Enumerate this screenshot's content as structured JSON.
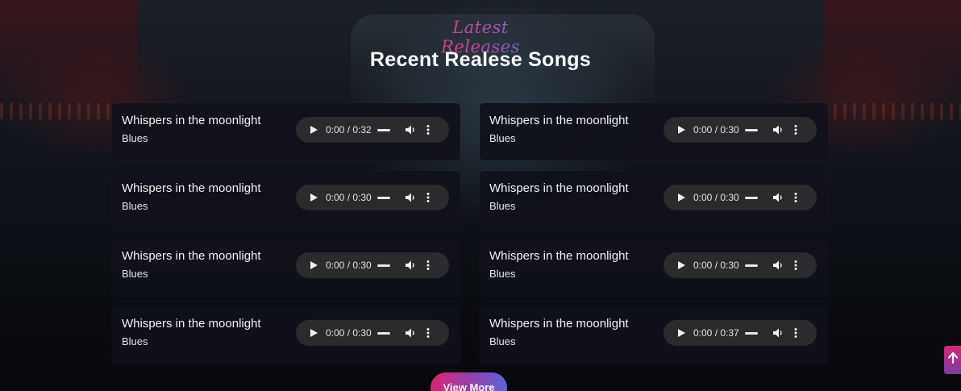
{
  "header": {
    "subtitle": "Latest Releases",
    "title": "Recent Realese Songs"
  },
  "songs": [
    {
      "title": "Whispers in the moonlight",
      "genre": "Blues",
      "time": "0:00 / 0:32"
    },
    {
      "title": "Whispers in the moonlight",
      "genre": "Blues",
      "time": "0:00 / 0:30"
    },
    {
      "title": "Whispers in the moonlight",
      "genre": "Blues",
      "time": "0:00 / 0:30"
    },
    {
      "title": "Whispers in the moonlight",
      "genre": "Blues",
      "time": "0:00 / 0:30"
    },
    {
      "title": "Whispers in the moonlight",
      "genre": "Blues",
      "time": "0:00 / 0:30"
    },
    {
      "title": "Whispers in the moonlight",
      "genre": "Blues",
      "time": "0:00 / 0:30"
    },
    {
      "title": "Whispers in the moonlight",
      "genre": "Blues",
      "time": "0:00 / 0:30"
    },
    {
      "title": "Whispers in the moonlight",
      "genre": "Blues",
      "time": "0:00 / 0:37"
    }
  ],
  "icons": {
    "play": "play-icon",
    "volume": "volume-icon",
    "more": "more-vertical-icon",
    "scroll_top": "arrow-up-icon"
  },
  "actions": {
    "view_more_label": "View More"
  },
  "colors": {
    "accent_pink": "#d9266f",
    "accent_blue": "#5a63d8",
    "card_bg": "#10111a",
    "player_bg": "#2b2a2d"
  }
}
